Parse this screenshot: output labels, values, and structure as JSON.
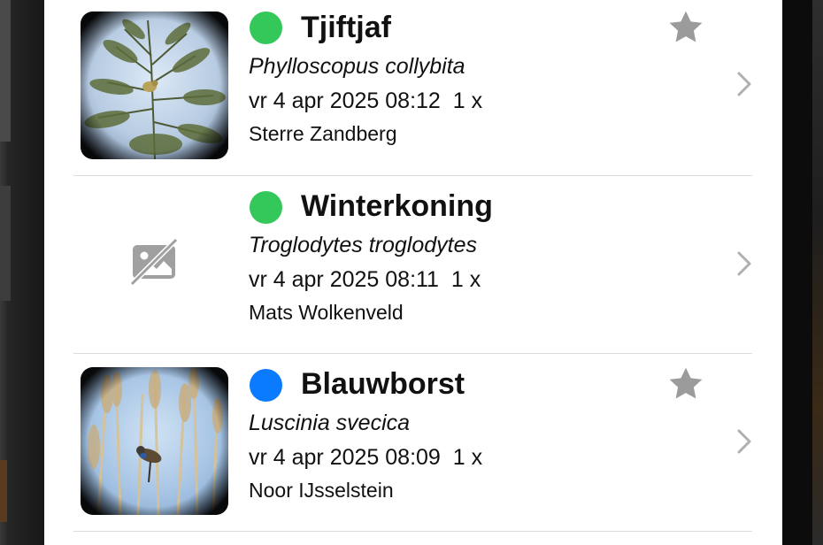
{
  "observations": [
    {
      "common_name": "Tjiftjaf",
      "scientific_name": "Phylloscopus collybita",
      "datetime": "vr 4 apr 2025 08:12",
      "count": "1 x",
      "observer": "Sterre Zandberg",
      "status_color": "#34c759",
      "has_photo": true,
      "favorite": true
    },
    {
      "common_name": "Winterkoning",
      "scientific_name": "Troglodytes troglodytes",
      "datetime": "vr 4 apr 2025 08:11",
      "count": "1 x",
      "observer": "Mats Wolkenveld",
      "status_color": "#34c759",
      "has_photo": false,
      "favorite": false
    },
    {
      "common_name": "Blauwborst",
      "scientific_name": "Luscinia svecica",
      "datetime": "vr 4 apr 2025 08:09",
      "count": "1 x",
      "observer": "Noor IJsselstein",
      "status_color": "#0a7aff",
      "has_photo": true,
      "favorite": true
    }
  ],
  "icons": {
    "favorite": "star-icon",
    "disclosure": "chevron-right-icon",
    "no_photo": "no-photo-icon"
  },
  "colors": {
    "icon_gray": "#9b9b9b",
    "separator": "#dcdcdc"
  }
}
